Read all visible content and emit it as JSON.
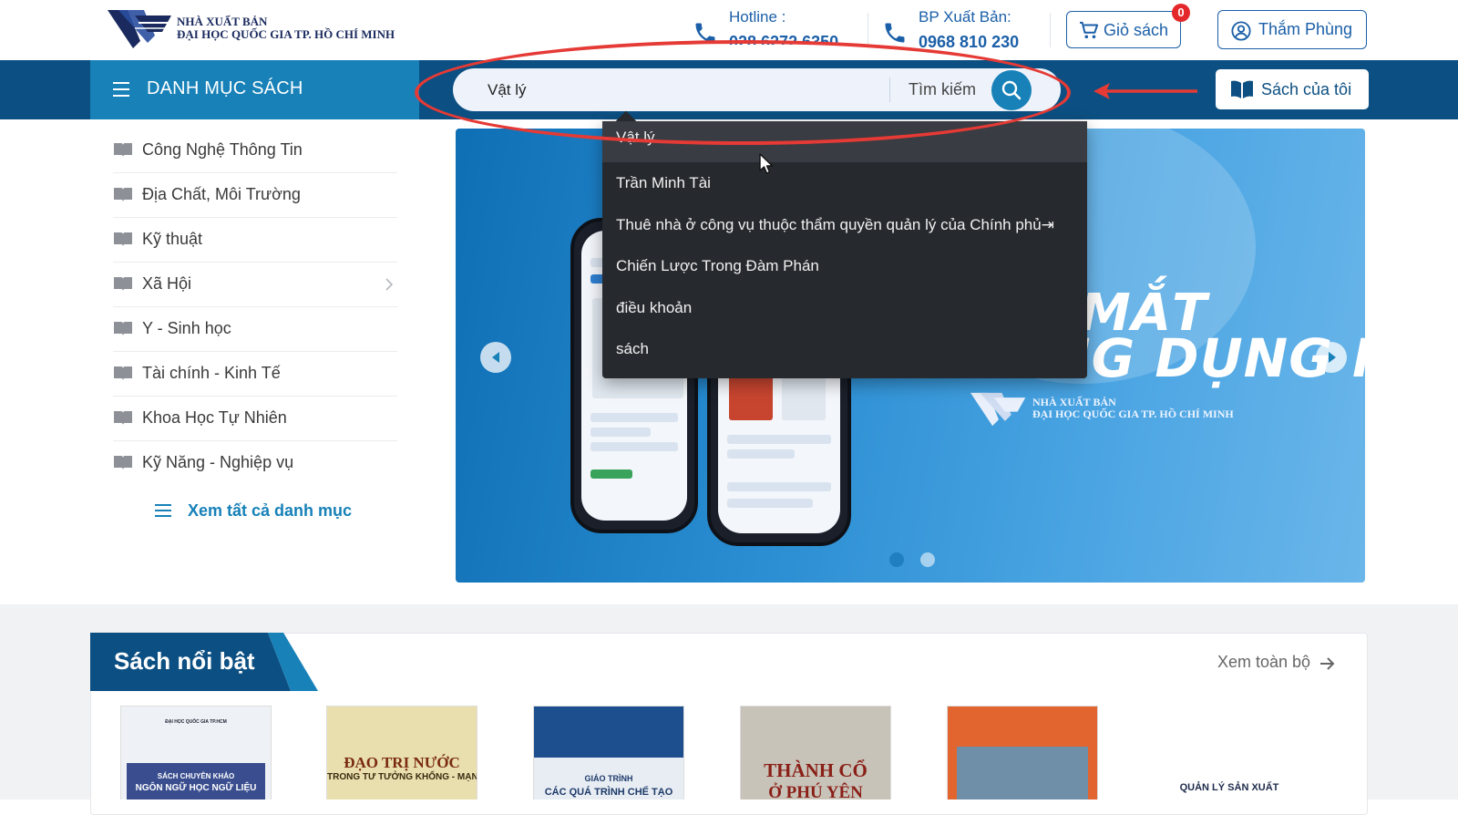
{
  "header": {
    "publisher_line1": "NHÀ XUẤT BẢN",
    "publisher_line2": "ĐẠI HỌC QUỐC GIA TP. HỒ CHÍ MINH",
    "hotline_label": "Hotline :",
    "hotline_value": "028.6272.6350",
    "bp_label": "BP Xuất Bản:",
    "bp_value": "0968 810 230",
    "cart_label": "Giỏ sách",
    "cart_count": "0",
    "user_name": "Thắm Phùng"
  },
  "nav": {
    "category_label": "DANH MỤC SÁCH",
    "search_value": "Vật lý",
    "search_button_label": "Tìm kiếm",
    "my_books_label": "Sách của tôi"
  },
  "search_suggestions": [
    "Vật lý",
    "Trần Minh Tài",
    "Thuê nhà ở công vụ thuộc thẩm quyền quản lý của Chính phủ⇥",
    "Chiến Lược Trong Đàm Phán",
    "điều khoản",
    "sách"
  ],
  "sidebar": {
    "items": [
      {
        "label": "Công Nghệ Thông Tin"
      },
      {
        "label": "Địa Chất, Môi Trường"
      },
      {
        "label": "Kỹ thuật"
      },
      {
        "label": "Xã Hội"
      },
      {
        "label": "Y - Sinh học"
      },
      {
        "label": "Tài chính - Kinh Tế"
      },
      {
        "label": "Khoa Học Tự Nhiên"
      },
      {
        "label": "Kỹ Năng - Nghiệp vụ"
      }
    ],
    "see_all_label": "Xem tất cả danh mục"
  },
  "banner": {
    "title_line1": "MẮT",
    "title_line2": "ỨNG DỤNG MỚI",
    "logo_line1": "NHÀ XUẤT BẢN",
    "logo_line2": "ĐẠI HỌC QUỐC GIA TP. HỒ CHÍ MINH"
  },
  "featured": {
    "title": "Sách nổi bật",
    "see_all_label": "Xem toàn bộ",
    "books": [
      {
        "title": "NGÔN NGỮ HỌC NGỮ LIỆU",
        "subtitle": "SÁCH CHUYÊN KHẢO"
      },
      {
        "title": "ĐẠO TRỊ NƯỚC",
        "subtitle": "TRONG TƯ TƯỞNG KHỔNG - MẠNH"
      },
      {
        "title": "CÁC QUÁ TRÌNH CHẾ TẠO",
        "subtitle": "GIÁO TRÌNH"
      },
      {
        "title": "THÀNH CỔ",
        "subtitle": "Ở PHÚ YÊN"
      },
      {
        "title": "",
        "subtitle": ""
      },
      {
        "title": "QUẢN LÝ SẢN XUẤT",
        "subtitle": ""
      }
    ]
  },
  "colors": {
    "nav_bg": "#0c4f82",
    "category_bg": "#1781b8",
    "annotation_red": "#e53a35",
    "dropdown_bg": "#26292e"
  }
}
